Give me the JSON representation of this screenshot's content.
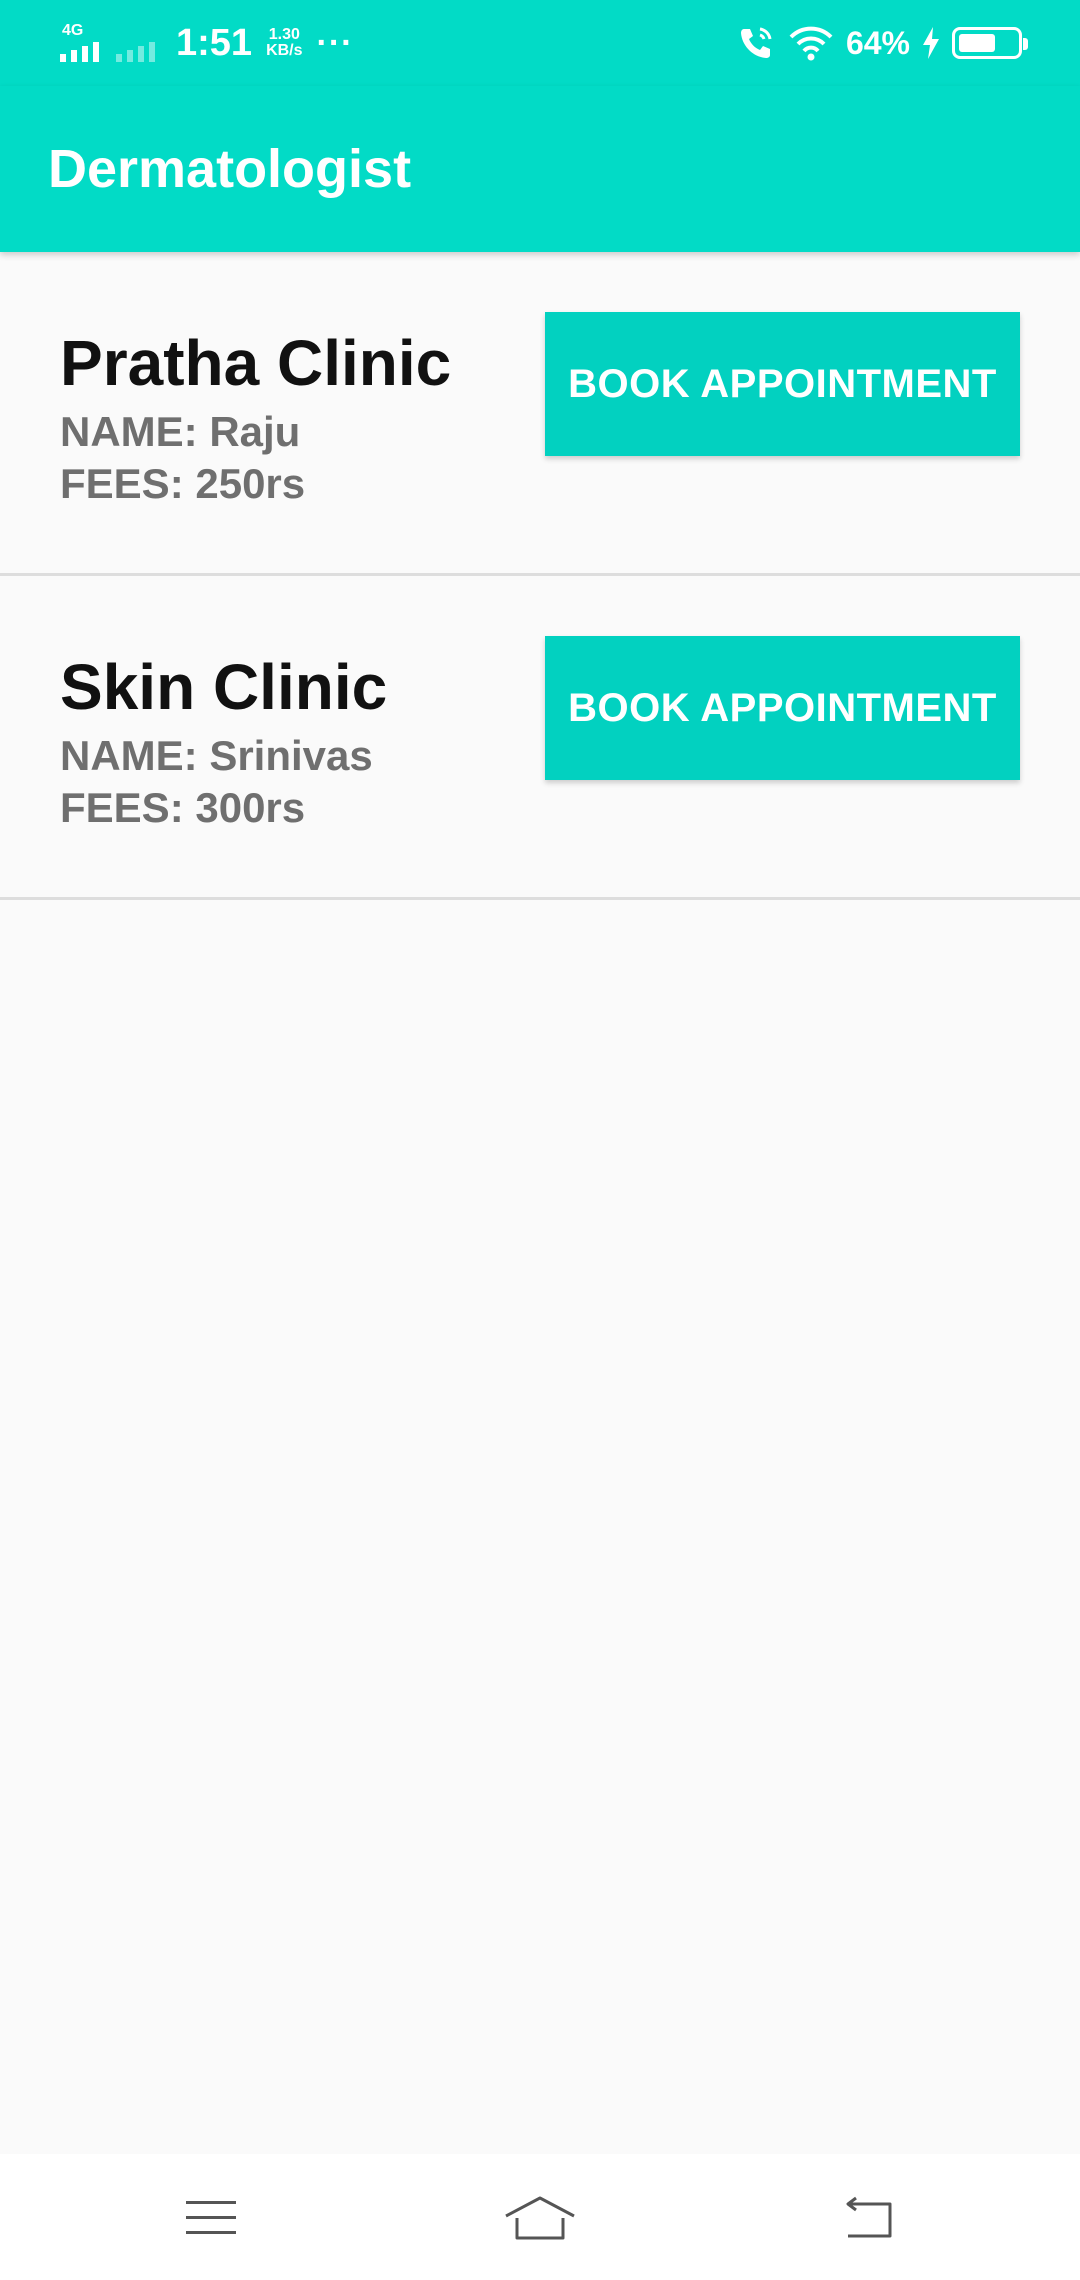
{
  "status_bar": {
    "network": "4G",
    "time": "1:51",
    "speed_value": "1.30",
    "speed_unit": "KB/s",
    "more": "···",
    "battery_pct": "64%",
    "battery_level": 0.64
  },
  "app_bar": {
    "title": "Dermatologist"
  },
  "clinics": [
    {
      "clinic_name": "Pratha Clinic",
      "doctor": "NAME: Raju",
      "fees": "FEES: 250rs",
      "button_label": "BOOK APPOINTMENT"
    },
    {
      "clinic_name": "Skin Clinic",
      "doctor": "NAME: Srinivas",
      "fees": "FEES: 300rs",
      "button_label": "BOOK APPOINTMENT"
    }
  ],
  "colors": {
    "primary": "#02dbc6",
    "button": "#02d1c0",
    "background": "#fafafa",
    "secondary_text": "#6f6f6f"
  },
  "nav_bar": {
    "icons": [
      "menu-icon",
      "home-icon",
      "back-icon"
    ]
  }
}
